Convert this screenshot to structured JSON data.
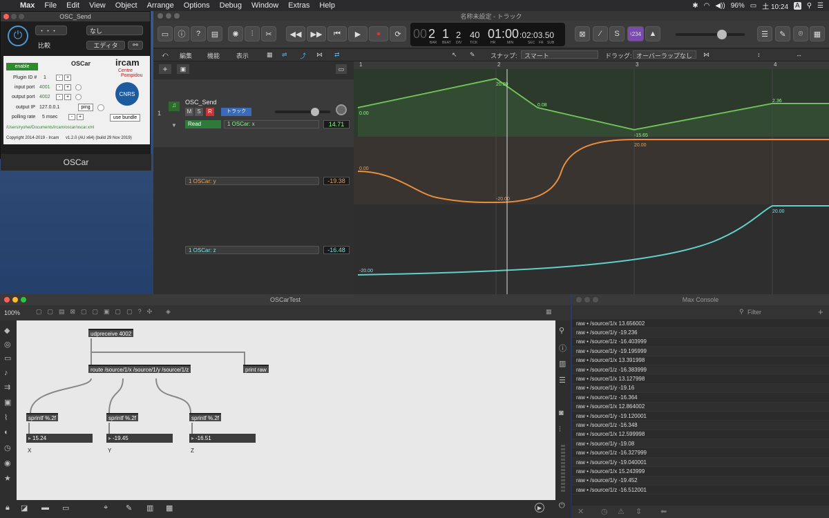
{
  "menubar": {
    "apple": "",
    "items": [
      "Max",
      "File",
      "Edit",
      "View",
      "Object",
      "Arrange",
      "Options",
      "Debug",
      "Window",
      "Extras",
      "Help"
    ],
    "battery": "96%",
    "time": "土 10:24",
    "input_mode": "A"
  },
  "plugin": {
    "title": "OSC_Send",
    "preset": "・・・",
    "bypass_sel": "なし",
    "compare": "比較",
    "editor": "エディタ",
    "enable": "enable",
    "name": "OSCar",
    "id_label": "Plugin ID #",
    "id_val": "1",
    "in_label": "input port",
    "in_val": "4001",
    "out_label": "output port",
    "out_val": "4002",
    "ip_label": "output IP",
    "ip_val": "127.0.0.1",
    "ping": "ping",
    "poll_label": "polling rate",
    "poll_val": "5 msec",
    "use_bundle": "use bundle",
    "path": "/Users/ryohei/Documents/ircam/oscar/oscar.xml",
    "copyright": "Copyright 2014-2019 - Ircam",
    "version": "v1.2.0 (AU x64) (build 29 Nov 2019)",
    "ircam": "ircam",
    "centre": "Centre",
    "pompidou": "Pompidou",
    "cnrs": "CNRS",
    "footer": "OSCar"
  },
  "logic": {
    "title": "名称未設定 - トラック",
    "lcd": {
      "bar": "2",
      "beat": "1",
      "div": "2",
      "tick": "40",
      "time": "01:00",
      "time_sub": ":02:03.50",
      "lab_bar": "BAR",
      "lab_beat": "BEAT",
      "lab_div": "DIV",
      "lab_tick": "TICK",
      "lab_hr": "HR",
      "lab_min": "MIN",
      "lab_sec": "SEC",
      "lab_fr": "FR",
      "lab_sub": "SUB",
      "prefix": "00"
    },
    "key": "♮234",
    "menu": {
      "edit": "編集",
      "func": "機能",
      "view": "表示",
      "snap_label": "スナップ:",
      "snap": "スマート",
      "drag_label": "ドラッグ:",
      "drag": "オーバーラップなし"
    },
    "track": {
      "num": "1",
      "name": "OSC_Send",
      "m": "M",
      "s": "S",
      "r": "R",
      "track_btn": "トラック",
      "read": "Read",
      "param_x": "1 OSCar: x",
      "val_x": "14.71",
      "param_y": "1 OSCar: y",
      "val_y": "-19.38",
      "param_z": "1 OSCar: z",
      "val_z": "-16.48"
    },
    "ruler": [
      "1",
      "2",
      "3",
      "4"
    ],
    "lane_x_labels": [
      "0.00",
      "20.00",
      "0.08",
      "-15.65",
      "2.36"
    ],
    "lane_y_labels": [
      "0.00",
      "-20.00",
      "20.00"
    ],
    "lane_z_labels": [
      "-20.00",
      "20.00"
    ]
  },
  "patcher": {
    "title": "OSCarTest",
    "zoom": "100%",
    "udp": "udpreceive 4002",
    "route": "route /source/1/x /source/1/y /source/1/z",
    "print": "print raw",
    "sprintf": "sprintf %.2f",
    "nx": "15.24",
    "ny": "-19.45",
    "nz": "-16.51",
    "cx": "X",
    "cy": "Y",
    "cz": "Z"
  },
  "console": {
    "title": "Max Console",
    "filter": "Filter",
    "rows": [
      "raw • /source/1/x 13.656002",
      "raw • /source/1/y -19.236",
      "raw • /source/1/z -16.403999",
      "raw • /source/1/y -19.195999",
      "raw • /source/1/x 13.391998",
      "raw • /source/1/z -16.383999",
      "raw • /source/1/x 13.127998",
      "raw • /source/1/y -19.16",
      "raw • /source/1/z -16.364",
      "raw • /source/1/x 12.864002",
      "raw • /source/1/y -19.120001",
      "raw • /source/1/z -16.348",
      "raw • /source/1/x 12.599998",
      "raw • /source/1/y -19.08",
      "raw • /source/1/z -16.327999",
      "raw • /source/1/y -19.040001",
      "raw • /source/1/x 15.243999",
      "raw • /source/1/y -19.452",
      "raw • /source/1/z -16.512001"
    ]
  }
}
